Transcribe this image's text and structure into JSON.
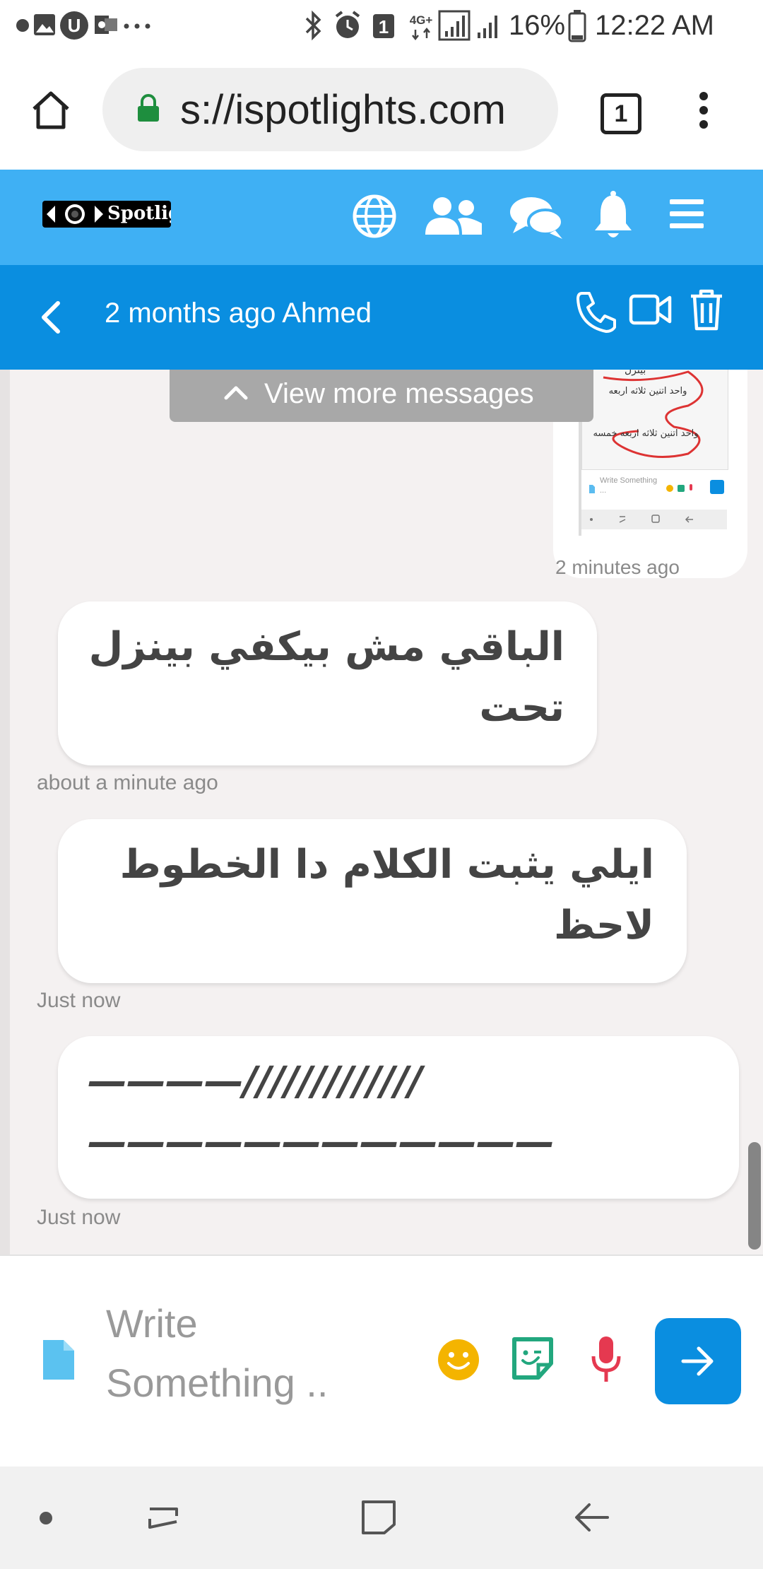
{
  "status_bar": {
    "battery": "16%",
    "time": "12:22 AM",
    "notification_badge": "1",
    "network": "4G+",
    "icons": [
      "android-notification-icon",
      "gallery-icon",
      "u-app-icon",
      "outlook-icon",
      "more-dots-icon",
      "bluetooth-icon",
      "alarm-icon",
      "sim-icon",
      "signal-icon",
      "battery-icon"
    ]
  },
  "browser": {
    "url": "s://ispotlights.com",
    "tab_count": "1",
    "icons": [
      "home-icon",
      "lock-icon",
      "menu-dots-icon"
    ]
  },
  "site_header": {
    "logo_text": "Spotlig",
    "icons": [
      "globe-icon",
      "users-icon",
      "chat-icon",
      "bell-icon",
      "hamburger-icon"
    ],
    "color": "#3fb0f4"
  },
  "chat_header": {
    "title": "2 months ago Ahmed",
    "color": "#0a8ee0",
    "icons": [
      "back-icon",
      "phone-icon",
      "video-icon",
      "trash-icon"
    ]
  },
  "messages": {
    "view_more_label": "View more messages",
    "image_card": {
      "lines": [
        "بينزل",
        "واحد اتنين ثلاثه اربعه",
        "واحد اتنين ثلاثه اربعه خمسه"
      ],
      "write_label": "Write Something ...",
      "timestamp": "2 minutes ago"
    },
    "items": [
      {
        "lines": [
          "الباقي مش بيكفي بينزل",
          "تحت"
        ],
        "time": "about a minute ago"
      },
      {
        "lines": [
          "ايلي يثبت الكلام دا الخطوط",
          "لاحظ"
        ],
        "time": "Just now"
      },
      {
        "lines": [
          "————/////////////",
          "————————————"
        ],
        "time": "Just now"
      }
    ]
  },
  "composer": {
    "placeholder_line1": "Write",
    "placeholder_line2": "Something ..",
    "icons": [
      "file-icon",
      "smiley-icon",
      "sticker-icon",
      "mic-icon",
      "arrow-right-icon"
    ],
    "send_color": "#0a8ee0"
  },
  "nav_bar": {
    "icons": [
      "dot-icon",
      "recent-apps-icon",
      "home-square-icon",
      "back-arrow-icon"
    ]
  }
}
